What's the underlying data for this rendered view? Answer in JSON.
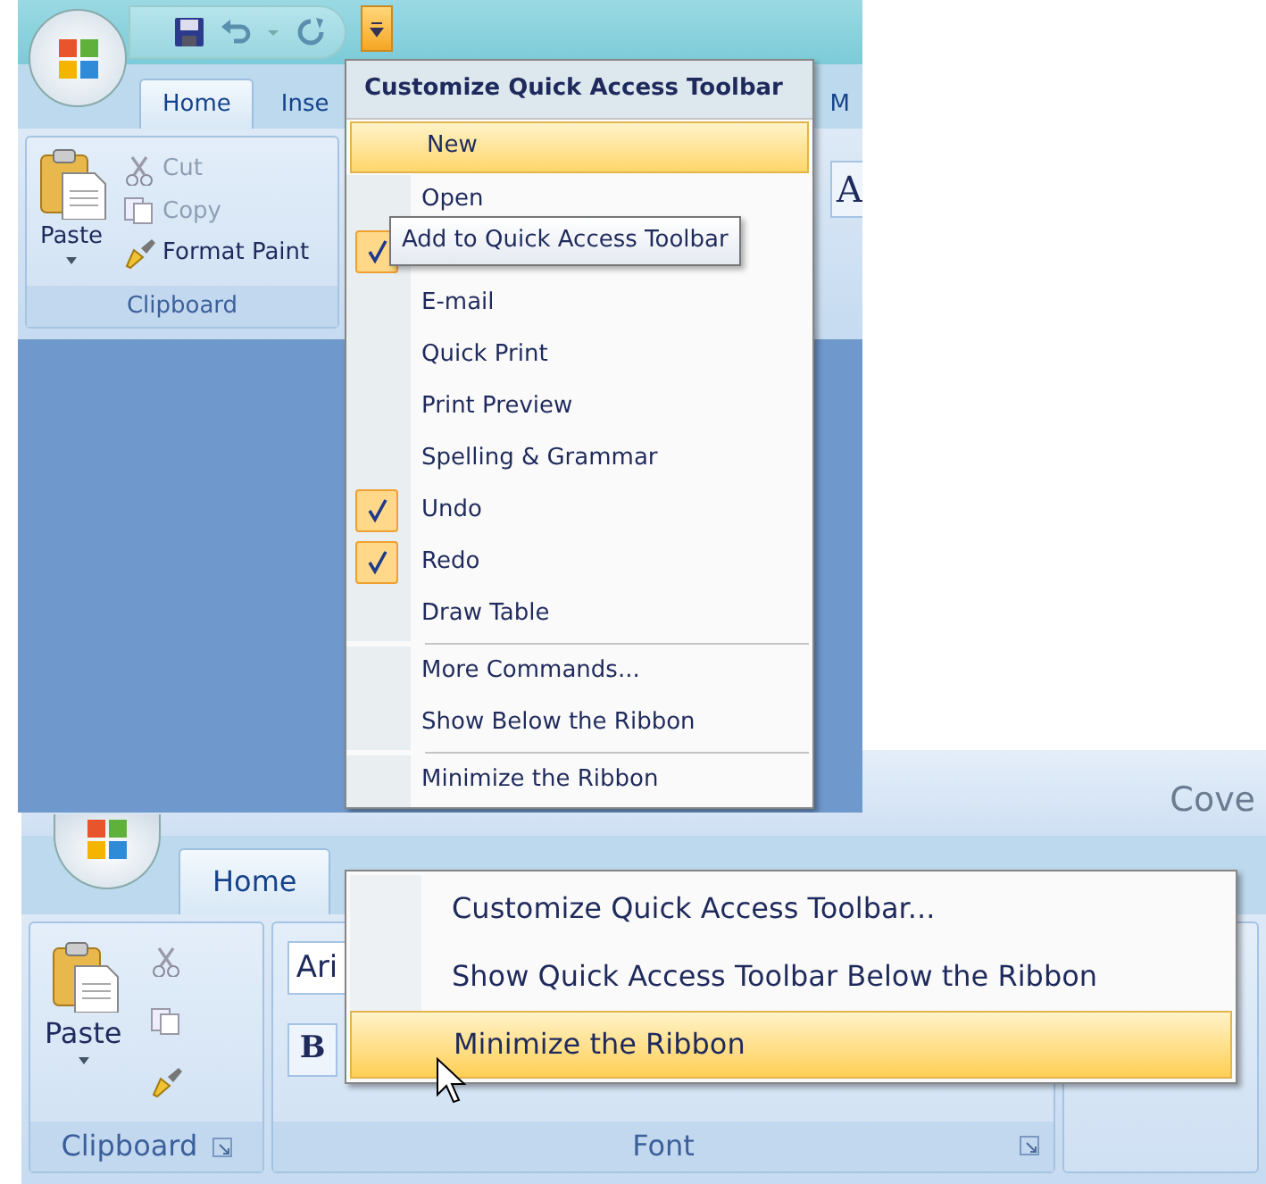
{
  "top_window": {
    "quick_access": {
      "customize_selected": true
    },
    "tabs": [
      {
        "label": "Home",
        "selected": true
      },
      {
        "label": "Inse",
        "selected": false
      },
      {
        "label": "M",
        "selected": false
      }
    ],
    "clipboard_group": {
      "paste": "Paste",
      "title": "Clipboard",
      "commands": [
        {
          "kind": "cut",
          "label": "Cut",
          "disabled": true
        },
        {
          "kind": "copy",
          "label": "Copy",
          "disabled": true
        },
        {
          "kind": "paint",
          "label": "Format Paint",
          "disabled": false
        }
      ]
    },
    "font_fragment": "A"
  },
  "qat_menu": {
    "title": "Customize Quick Access Toolbar",
    "items": [
      {
        "kind": "command",
        "label": "New",
        "checked": false,
        "highlighted": true
      },
      {
        "kind": "command",
        "label": "Open",
        "checked": false,
        "highlighted": false
      },
      {
        "kind": "command",
        "checked": true,
        "highlighted": false
      },
      {
        "kind": "command",
        "label": "E-mail",
        "checked": false,
        "highlighted": false
      },
      {
        "kind": "command",
        "label": "Quick Print",
        "checked": false,
        "highlighted": false
      },
      {
        "kind": "command",
        "label": "Print Preview",
        "checked": false,
        "highlighted": false
      },
      {
        "kind": "command",
        "label": "Spelling & Grammar",
        "checked": false,
        "highlighted": false
      },
      {
        "kind": "command",
        "label": "Undo",
        "checked": true,
        "highlighted": false
      },
      {
        "kind": "command",
        "label": "Redo",
        "checked": true,
        "highlighted": false
      },
      {
        "kind": "command",
        "label": "Draw Table",
        "checked": false,
        "highlighted": false
      },
      {
        "kind": "separator"
      },
      {
        "kind": "command",
        "label": "More Commands...",
        "checked": false,
        "highlighted": false
      },
      {
        "kind": "command",
        "label": "Show Below the Ribbon",
        "checked": false,
        "highlighted": false
      },
      {
        "kind": "separator"
      },
      {
        "kind": "command",
        "label": "Minimize the Ribbon",
        "checked": false,
        "highlighted": false
      }
    ]
  },
  "tooltip": "Add to Quick Access Toolbar",
  "bottom_window": {
    "title": "Cove",
    "tabs": [
      {
        "label": "Home",
        "selected": true
      }
    ],
    "clipboard_group": {
      "paste": "Paste",
      "title": "Clipboard"
    },
    "font_group": {
      "font_name": "Ari",
      "bold_label": "B",
      "title": "Font"
    },
    "context_menu": {
      "items": [
        {
          "label": "Customize Quick Access Toolbar...",
          "highlighted": false
        },
        {
          "label": "Show Quick Access Toolbar Below the Ribbon",
          "highlighted": false
        },
        {
          "label": "Minimize the Ribbon",
          "highlighted": true
        }
      ]
    }
  }
}
